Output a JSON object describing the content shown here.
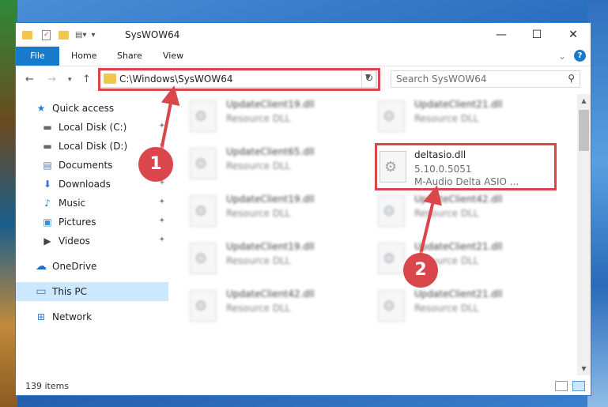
{
  "window": {
    "title": "SysWOW64",
    "controls": {
      "minimize": "—",
      "maximize": "☐",
      "close": "✕"
    }
  },
  "ribbon": {
    "tabs": [
      "File",
      "Home",
      "Share",
      "View"
    ],
    "expand_glyph": "⌄",
    "help_glyph": "?"
  },
  "address_bar": {
    "path": "C:\\Windows\\SysWOW64",
    "refresh_glyph": "↻",
    "dropdown_glyph": "▼"
  },
  "search": {
    "placeholder": "Search SysWOW64",
    "icon_glyph": "⚲"
  },
  "sidebar": {
    "items": [
      {
        "label": "Quick access",
        "icon": "star-icon",
        "glyph": "★"
      },
      {
        "label": "Local Disk (C:)",
        "icon": "drive-icon",
        "glyph": "▬",
        "pinned": true
      },
      {
        "label": "Local Disk (D:)",
        "icon": "drive-icon",
        "glyph": "▬",
        "pinned": true
      },
      {
        "label": "Documents",
        "icon": "documents-icon",
        "glyph": "▤",
        "pinned": true
      },
      {
        "label": "Downloads",
        "icon": "download-icon",
        "glyph": "⬇",
        "pinned": true
      },
      {
        "label": "Music",
        "icon": "music-icon",
        "glyph": "♪",
        "pinned": true
      },
      {
        "label": "Pictures",
        "icon": "pictures-icon",
        "glyph": "▣",
        "pinned": true
      },
      {
        "label": "Videos",
        "icon": "videos-icon",
        "glyph": "▶",
        "pinned": true
      },
      {
        "label": "OneDrive",
        "icon": "cloud-icon",
        "glyph": "☁"
      },
      {
        "label": "This PC",
        "icon": "computer-icon",
        "glyph": "▭",
        "selected": true
      },
      {
        "label": "Network",
        "icon": "network-icon",
        "glyph": "⊞"
      }
    ],
    "pin_glyph": "✦"
  },
  "files": {
    "left_column": [
      {
        "name": "UpdateClient19.dll",
        "type": "Resource DLL"
      },
      {
        "name": "UpdateClient65.dll",
        "type": "Resource DLL"
      },
      {
        "name": "UpdateClient19.dll",
        "type": "Resource DLL"
      },
      {
        "name": "UpdateClient19.dll",
        "type": "Resource DLL"
      },
      {
        "name": "UpdateClient42.dll",
        "type": "Resource DLL"
      }
    ],
    "right_column": [
      {
        "name": "UpdateClient21.dll",
        "type": "Resource DLL"
      },
      {
        "name": "deltasio.dll",
        "version": "5.10.0.5051",
        "description": "M-Audio Delta ASIO ...",
        "highlighted": true
      },
      {
        "name": "UpdateClient42.dll",
        "type": "Resource DLL"
      },
      {
        "name": "UpdateClient21.dll",
        "type": "Resource DLL"
      },
      {
        "name": "UpdateClient21.dll",
        "type": "Resource DLL"
      }
    ]
  },
  "status_bar": {
    "item_count": "139 items"
  },
  "callouts": [
    "1",
    "2"
  ],
  "colors": {
    "accent": "#1979ca",
    "highlight": "#d9464b",
    "selected": "#cce8ff"
  }
}
